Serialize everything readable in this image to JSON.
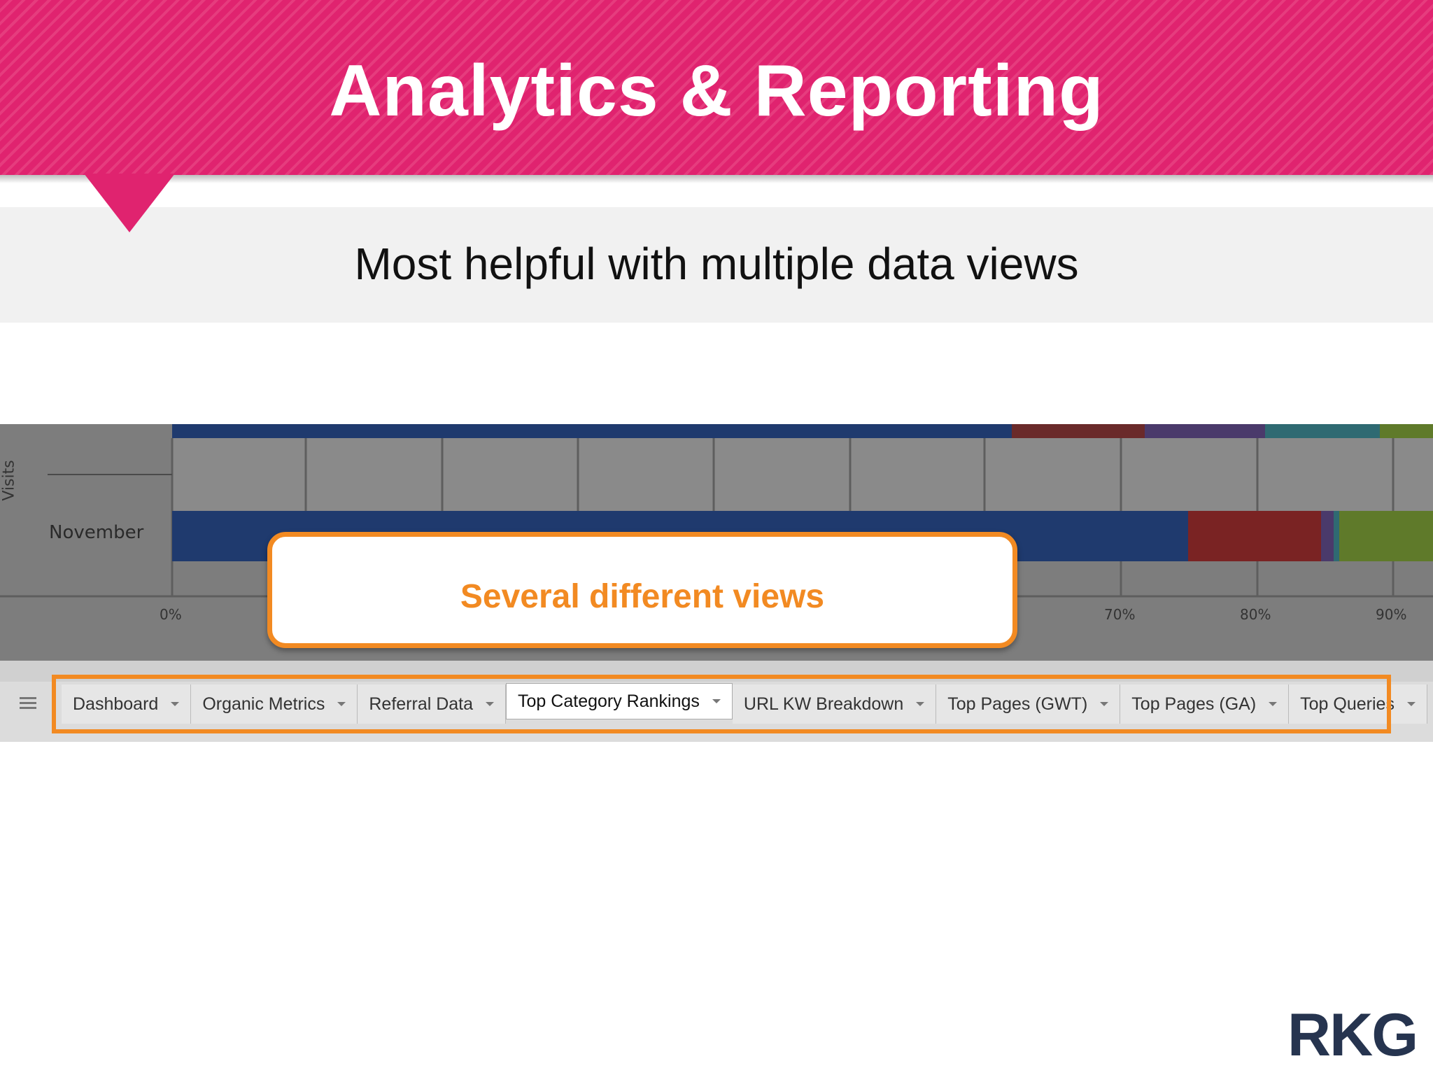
{
  "header": {
    "title": "Analytics & Reporting"
  },
  "subtitle": "Most helpful with multiple data views",
  "chart_screenshot": {
    "ylabel": "Visits",
    "row_label": "November",
    "tick_labels": [
      "0%",
      "70%",
      "80%",
      "90%"
    ],
    "bar_colors": {
      "primary": "#1f3a6e",
      "red": "#7a2323",
      "purple": "#4a3a6b",
      "green": "#5f7a2a"
    }
  },
  "callout": {
    "text": "Several different views",
    "color": "#f28a22"
  },
  "sheet_tabs": [
    {
      "label": "Dashboard",
      "active": false
    },
    {
      "label": "Organic Metrics",
      "active": false
    },
    {
      "label": "Referral Data",
      "active": false
    },
    {
      "label": "Top Category Rankings",
      "active": true
    },
    {
      "label": "URL KW Breakdown",
      "active": false
    },
    {
      "label": "Top Pages (GWT)",
      "active": false
    },
    {
      "label": "Top Pages (GA)",
      "active": false
    },
    {
      "label": "Top Queries",
      "active": false
    }
  ],
  "logo": {
    "text": "RKG"
  },
  "colors": {
    "banner": "#e0236f",
    "accent": "#f28a22",
    "logo": "#26344f"
  }
}
